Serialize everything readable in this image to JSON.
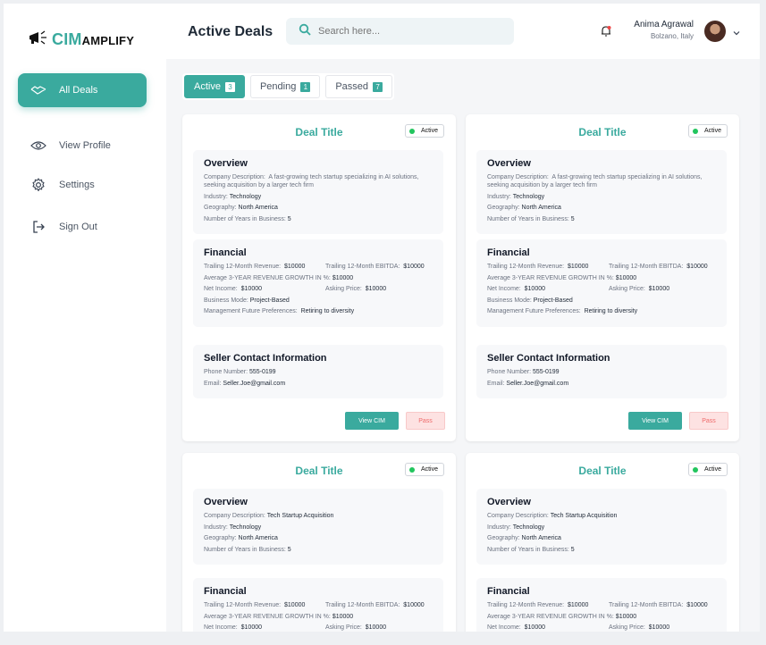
{
  "app": {
    "logo_text_cim": "CIM",
    "logo_text_rest": "AMPLIFY"
  },
  "sidebar": {
    "items": [
      {
        "label": "All Deals",
        "icon": "handshake-icon"
      },
      {
        "label": "View Profile",
        "icon": "eye-icon"
      },
      {
        "label": "Settings",
        "icon": "gear-icon"
      },
      {
        "label": "Sign Out",
        "icon": "sign-out-icon"
      }
    ]
  },
  "header": {
    "title": "Active Deals",
    "search_placeholder": "Search here...",
    "user_name": "Anima Agrawal",
    "user_location": "Bolzano, Italy"
  },
  "tabs": [
    {
      "label": "Active",
      "count": "3"
    },
    {
      "label": "Pending",
      "count": "1"
    },
    {
      "label": "Passed",
      "count": "7"
    }
  ],
  "colors": {
    "accent": "#3aaa9e",
    "status_active": "#22c55e",
    "pass_bg": "#fde2e2",
    "pass_text": "#ef6b6b"
  },
  "deals": [
    {
      "title": "Deal Title",
      "status": "Active",
      "overview": {
        "heading": "Overview",
        "desc_label": "Company Description:",
        "desc_value": "A fast-growing tech startup specializing in AI solutions, seeking acquisition by a larger tech firm",
        "industry_label": "Industry:",
        "industry_value": "Technology",
        "geo_label": "Geography:",
        "geo_value": "North America",
        "years_label": "Number of Years in Business:",
        "years_value": "5"
      },
      "financial": {
        "heading": "Financial",
        "rev_label": "Trailing 12-Month Revenue:",
        "rev_value": "$10000",
        "ebitda_label": "Trailing 12-Month EBITDA:",
        "ebitda_value": "$10000",
        "growth_label": "Average 3-YEAR REVENUE GROWTH IN %:",
        "growth_value": "$10000",
        "net_label": "Net Income:",
        "net_value": "$10000",
        "ask_label": "Asking Price:",
        "ask_value": "$10000",
        "mode_label": "Business Mode:",
        "mode_value": "Project-Based",
        "pref_label": "Management Future Preferences:",
        "pref_value": "Retiring to diversity"
      },
      "seller": {
        "heading": "Seller Contact Information",
        "phone_label": "Phone Number:",
        "phone_value": "555-0199",
        "email_label": "Email:",
        "email_value": "Seller.Joe@gmail.com"
      },
      "view_label": "View CIM",
      "pass_label": "Pass"
    },
    {
      "title": "Deal Title",
      "status": "Active",
      "overview": {
        "heading": "Overview",
        "desc_label": "Company Description:",
        "desc_value": "A fast-growing tech startup specializing in AI solutions, seeking acquisition by a larger tech firm",
        "industry_label": "Industry:",
        "industry_value": "Technology",
        "geo_label": "Geography:",
        "geo_value": "North America",
        "years_label": "Number of Years in Business:",
        "years_value": "5"
      },
      "financial": {
        "heading": "Financial",
        "rev_label": "Trailing 12-Month Revenue:",
        "rev_value": "$10000",
        "ebitda_label": "Trailing 12-Month EBITDA:",
        "ebitda_value": "$10000",
        "growth_label": "Average 3-YEAR REVENUE GROWTH IN %:",
        "growth_value": "$10000",
        "net_label": "Net Income:",
        "net_value": "$10000",
        "ask_label": "Asking Price:",
        "ask_value": "$10000",
        "mode_label": "Business Mode:",
        "mode_value": "Project-Based",
        "pref_label": "Management Future Preferences:",
        "pref_value": "Retiring to diversity"
      },
      "seller": {
        "heading": "Seller Contact Information",
        "phone_label": "Phone Number:",
        "phone_value": "555-0199",
        "email_label": "Email:",
        "email_value": "Seller.Joe@gmail.com"
      },
      "view_label": "View CIM",
      "pass_label": "Pass"
    },
    {
      "title": "Deal Title",
      "status": "Active",
      "overview": {
        "heading": "Overview",
        "desc_label": "Company Description:",
        "desc_value": "Tech Startup Acquisition",
        "industry_label": "Industry:",
        "industry_value": "Technology",
        "geo_label": "Geography:",
        "geo_value": "North America",
        "years_label": "Number of Years in Business:",
        "years_value": "5"
      },
      "financial": {
        "heading": "Financial",
        "rev_label": "Trailing 12-Month Revenue:",
        "rev_value": "$10000",
        "ebitda_label": "Trailing 12-Month EBITDA:",
        "ebitda_value": "$10000",
        "growth_label": "Average 3-YEAR REVENUE GROWTH IN %:",
        "growth_value": "$10000",
        "net_label": "Net Income:",
        "net_value": "$10000",
        "ask_label": "Asking Price:",
        "ask_value": "$10000"
      }
    },
    {
      "title": "Deal Title",
      "status": "Active",
      "overview": {
        "heading": "Overview",
        "desc_label": "Company Description:",
        "desc_value": "Tech Startup Acquisition",
        "industry_label": "Industry:",
        "industry_value": "Technology",
        "geo_label": "Geography:",
        "geo_value": "North America",
        "years_label": "Number of Years in Business:",
        "years_value": "5"
      },
      "financial": {
        "heading": "Financial",
        "rev_label": "Trailing 12-Month Revenue:",
        "rev_value": "$10000",
        "ebitda_label": "Trailing 12-Month EBITDA:",
        "ebitda_value": "$10000",
        "growth_label": "Average 3-YEAR REVENUE GROWTH IN %:",
        "growth_value": "$10000",
        "net_label": "Net Income:",
        "net_value": "$10000",
        "ask_label": "Asking Price:",
        "ask_value": "$10000"
      }
    }
  ]
}
